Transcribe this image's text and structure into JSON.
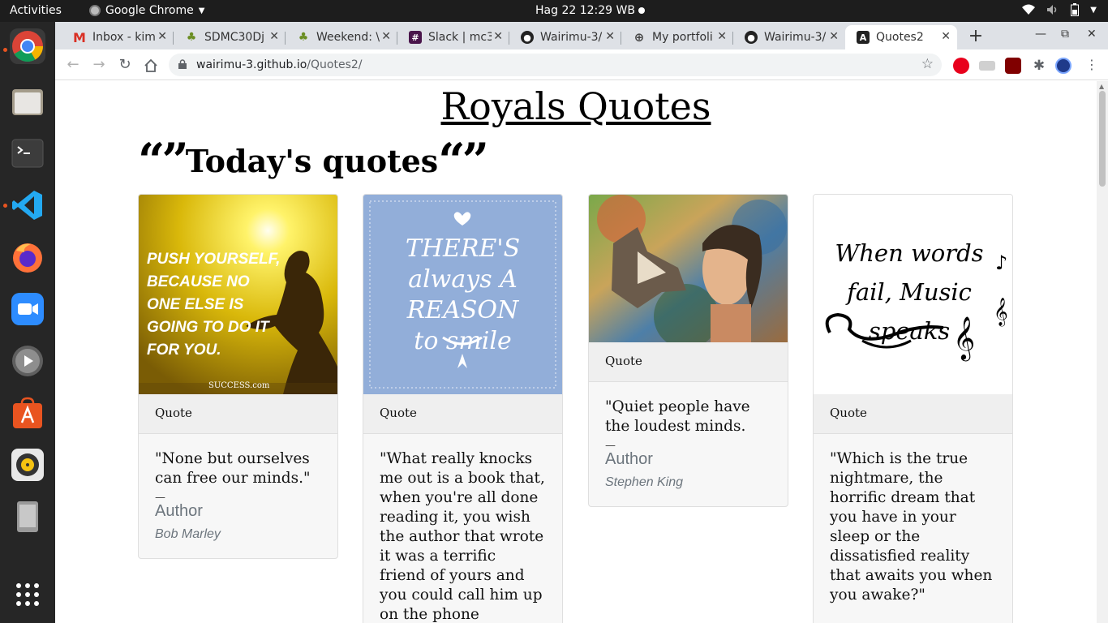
{
  "topbar": {
    "activities": "Activities",
    "app_name": "Google Chrome",
    "clock": "Hag 22  12:29 WB"
  },
  "browser": {
    "tabs": [
      {
        "title": "Inbox - kim",
        "favicon": "gmail-icon"
      },
      {
        "title": "SDMC30Dj",
        "favicon": "plant-icon"
      },
      {
        "title": "Weekend: \\",
        "favicon": "plant-icon"
      },
      {
        "title": "Slack | mc3",
        "favicon": "slack-icon"
      },
      {
        "title": "Wairimu-3/",
        "favicon": "github-icon"
      },
      {
        "title": "My portfoli",
        "favicon": "globe-icon"
      },
      {
        "title": "Wairimu-3/",
        "favicon": "github-icon"
      },
      {
        "title": "Quotes2",
        "favicon": "angular-icon"
      }
    ],
    "url_host": "wairimu-3.github.io",
    "url_path": "/Quotes2/"
  },
  "page": {
    "site_title": "Royals Quotes",
    "section_title": "Today's  quotes",
    "cards": [
      {
        "header": "Quote",
        "image_caption": "PUSH YOURSELF, BECAUSE NO ONE ELSE IS GOING TO DO IT FOR YOU.",
        "image_credit": "SUCCESS.com",
        "text": "\"None but ourselves can free our minds.\"",
        "dash": "—",
        "author_label": "Author",
        "author": "Bob Marley"
      },
      {
        "header": "Quote",
        "image_caption": "THERE'S always A REASON to smile",
        "text": "\"What really knocks me out is a book that, when you're all done reading it, you wish the author that wrote it was a terrific friend of yours and you could call him up on the phone",
        "dash": "",
        "author_label": "",
        "author": ""
      },
      {
        "header": "Quote",
        "text": "\"Quiet people have the loudest minds.",
        "dash": "—",
        "author_label": "Author",
        "author": "Stephen King"
      },
      {
        "header": "Quote",
        "image_caption": "When words fail, Music speaks",
        "text": "\"Which is the true nightmare, the horrific dream that you have in your sleep or the dissatisfied reality that awaits you when you awake?\"",
        "dash": "",
        "author_label": "",
        "author": ""
      }
    ]
  },
  "colors": {
    "topbar_bg": "#1d1d1d",
    "dock_bg": "#262626",
    "tabstrip_bg": "#dee1e6",
    "card_bg": "#f7f7f7",
    "card_header_bg": "#efefef",
    "muted_text": "#6c757d"
  }
}
